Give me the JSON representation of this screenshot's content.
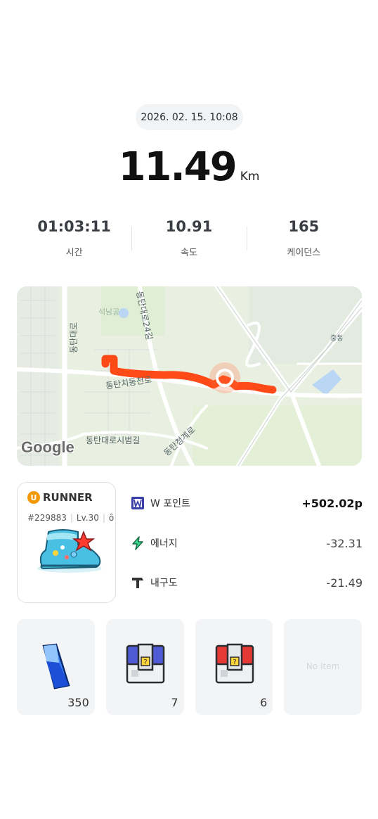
{
  "header": {
    "datetime": "2026. 02. 15. 10:08"
  },
  "distance": {
    "value": "11.49",
    "unit": "Km"
  },
  "stats": [
    {
      "value": "01:03:11",
      "label": "시간"
    },
    {
      "value": "10.91",
      "label": "속도"
    },
    {
      "value": "165",
      "label": "케이던스"
    }
  ],
  "map": {
    "labels": [
      "동탄대로24길",
      "중동",
      "동탄대로",
      "동탄치동천로",
      "동탄대로시범길",
      "동탄청계로",
      "석남공"
    ],
    "attribution": "Google",
    "route_color": "#ff4a17"
  },
  "runner": {
    "brand_initial": "U",
    "name": "RUNNER",
    "id": "#229883",
    "level": "Lv.30",
    "badge_color": "#f39800"
  },
  "rewards": [
    {
      "icon": "w-point-icon",
      "name": "W 포인트",
      "amount": "+502.02p"
    },
    {
      "icon": "energy-bolt-icon",
      "name": "에너지",
      "amount": "-32.31"
    },
    {
      "icon": "durability-hammer-icon",
      "name": "내구도",
      "amount": "-21.49"
    }
  ],
  "items": [
    {
      "icon": "blue-crystal-icon",
      "count": "350"
    },
    {
      "icon": "blue-mystery-box-icon",
      "count": "7"
    },
    {
      "icon": "red-mystery-box-icon",
      "count": "6"
    },
    {
      "icon": "",
      "empty_label": "No Item"
    }
  ]
}
